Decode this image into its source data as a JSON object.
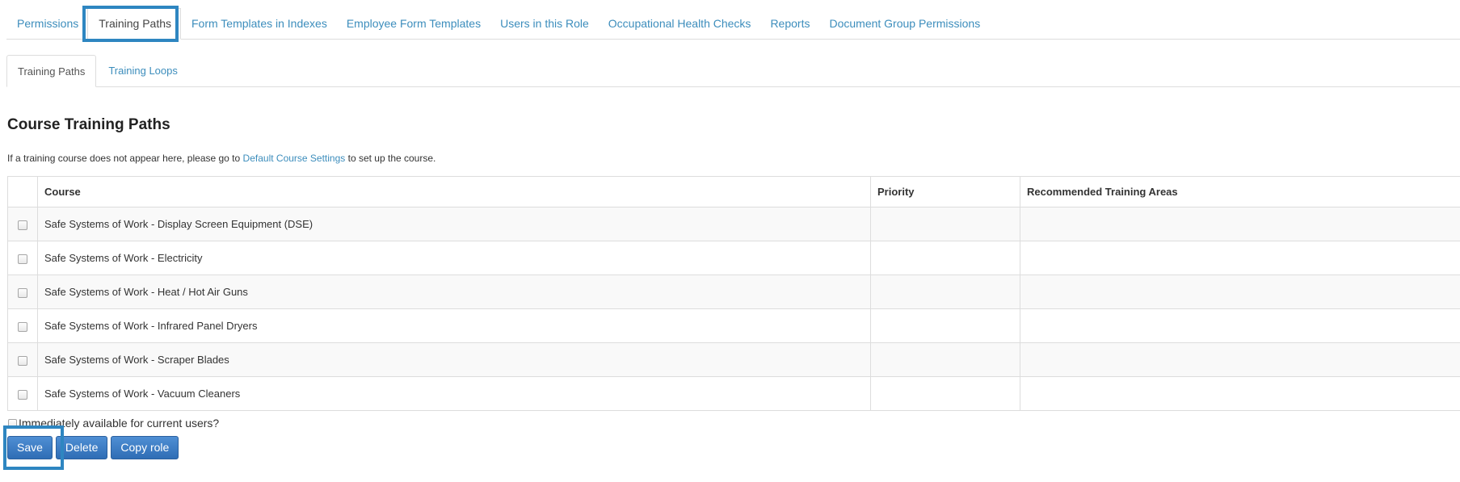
{
  "top_tabs": [
    {
      "label": "Permissions"
    },
    {
      "label": "Training Paths"
    },
    {
      "label": "Form Templates in Indexes"
    },
    {
      "label": "Employee Form Templates"
    },
    {
      "label": "Users in this Role"
    },
    {
      "label": "Occupational Health Checks"
    },
    {
      "label": "Reports"
    },
    {
      "label": "Document Group Permissions"
    }
  ],
  "sub_tabs": [
    {
      "label": "Training Paths"
    },
    {
      "label": "Training Loops"
    }
  ],
  "section": {
    "title": "Course Training Paths",
    "info_prefix": "If a training course does not appear here, please go to",
    "info_link": "Default Course Settings",
    "info_suffix": "to set up the course."
  },
  "table": {
    "headers": {
      "course": "Course",
      "priority": "Priority",
      "areas": "Recommended Training Areas"
    },
    "rows": [
      {
        "course": "Safe Systems of Work - Display Screen Equipment (DSE)",
        "priority": "",
        "areas": ""
      },
      {
        "course": "Safe Systems of Work - Electricity",
        "priority": "",
        "areas": ""
      },
      {
        "course": "Safe Systems of Work - Heat / Hot Air Guns",
        "priority": "",
        "areas": ""
      },
      {
        "course": "Safe Systems of Work - Infrared Panel Dryers",
        "priority": "",
        "areas": ""
      },
      {
        "course": "Safe Systems of Work - Scraper Blades",
        "priority": "",
        "areas": ""
      },
      {
        "course": "Safe Systems of Work - Vacuum Cleaners",
        "priority": "",
        "areas": ""
      }
    ]
  },
  "immediately_label": "Immediately available for current users?",
  "buttons": {
    "save": "Save",
    "delete": "Delete",
    "copy": "Copy role"
  },
  "colors": {
    "link": "#3c8dbc",
    "highlight": "#2e86c1",
    "button": "#3a7bc8"
  }
}
